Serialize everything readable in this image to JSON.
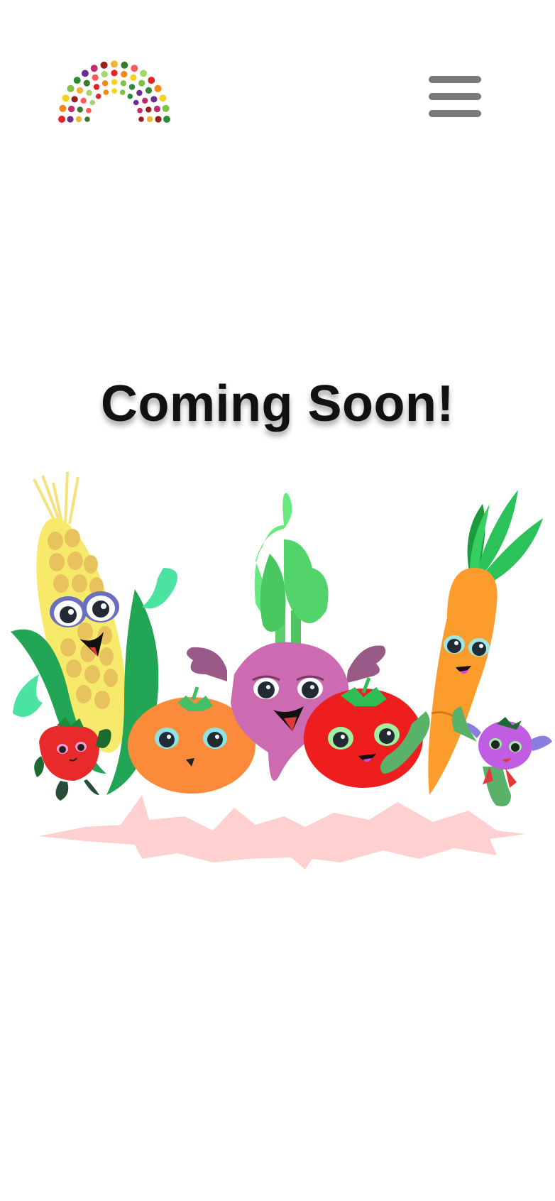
{
  "header": {
    "logo_name": "fruit-rainbow-logo",
    "menu_icon": "hamburger-menu-icon"
  },
  "main": {
    "title": "Coming Soon!",
    "illustration_name": "cartoon-vegetables-group"
  },
  "colors": {
    "menu_bars": "#7a7a7a",
    "title": "#111111",
    "background": "#ffffff"
  }
}
